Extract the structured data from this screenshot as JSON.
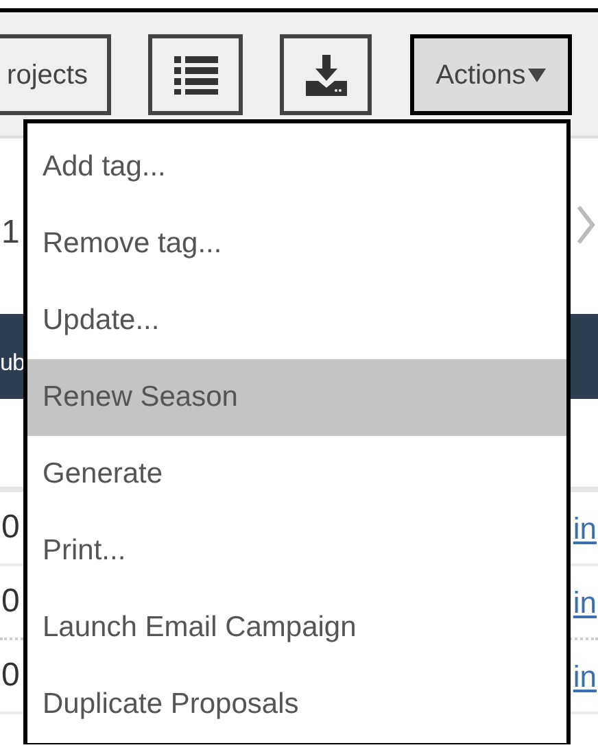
{
  "toolbar": {
    "projects_button": "rojects",
    "actions_button": {
      "label": "Actions",
      "expanded": true
    }
  },
  "pager": {
    "page": "1"
  },
  "table": {
    "header": "ub",
    "rows": [
      {
        "column_1": "0",
        "column_2": "in"
      },
      {
        "column_1": "0",
        "column_2": "in"
      },
      {
        "column_1": "0",
        "column_2": "in"
      }
    ]
  },
  "actions_menu": {
    "items": [
      {
        "label": "Add tag...",
        "selected": false
      },
      {
        "label": "Remove tag...",
        "selected": false
      },
      {
        "label": "Update...",
        "selected": false
      },
      {
        "label": "Renew Season",
        "selected": true
      },
      {
        "label": "Generate",
        "selected": false
      },
      {
        "label": "Print...",
        "selected": false
      },
      {
        "label": "Launch Email Campaign",
        "selected": false
      },
      {
        "label": "Duplicate Proposals",
        "selected": false
      }
    ]
  }
}
